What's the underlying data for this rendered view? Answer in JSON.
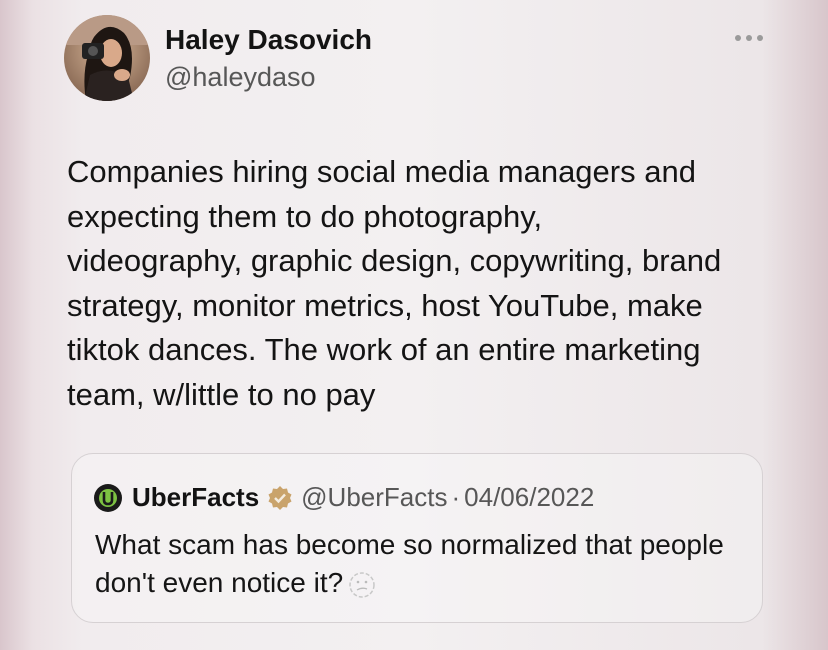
{
  "tweet": {
    "author_name": "Haley Dasovich",
    "author_handle": "@haleydaso",
    "more_icon": "ellipsis-icon",
    "body_lines": [
      "Companies hiring social media managers and",
      "expecting them to do photography,",
      "videography, graphic design, copywriting, brand",
      "strategy, monitor metrics, host YouTube, make",
      "tiktok dances. The work of an entire marketing",
      "team, w/little to no pay"
    ]
  },
  "quote": {
    "author_name": "UberFacts",
    "author_handle": "@UberFacts",
    "separator": "·",
    "date": "04/06/2022",
    "text_lines": [
      "What scam has become so normalized that people",
      "don't even notice it?"
    ],
    "verified_color": "#c9a36b",
    "logo_icon": "uberfacts-logo-icon",
    "emoji_icon": "thinking-face-emoji"
  },
  "colors": {
    "text_primary": "#131313",
    "text_secondary": "#575757",
    "border": "#d6d1d3"
  }
}
